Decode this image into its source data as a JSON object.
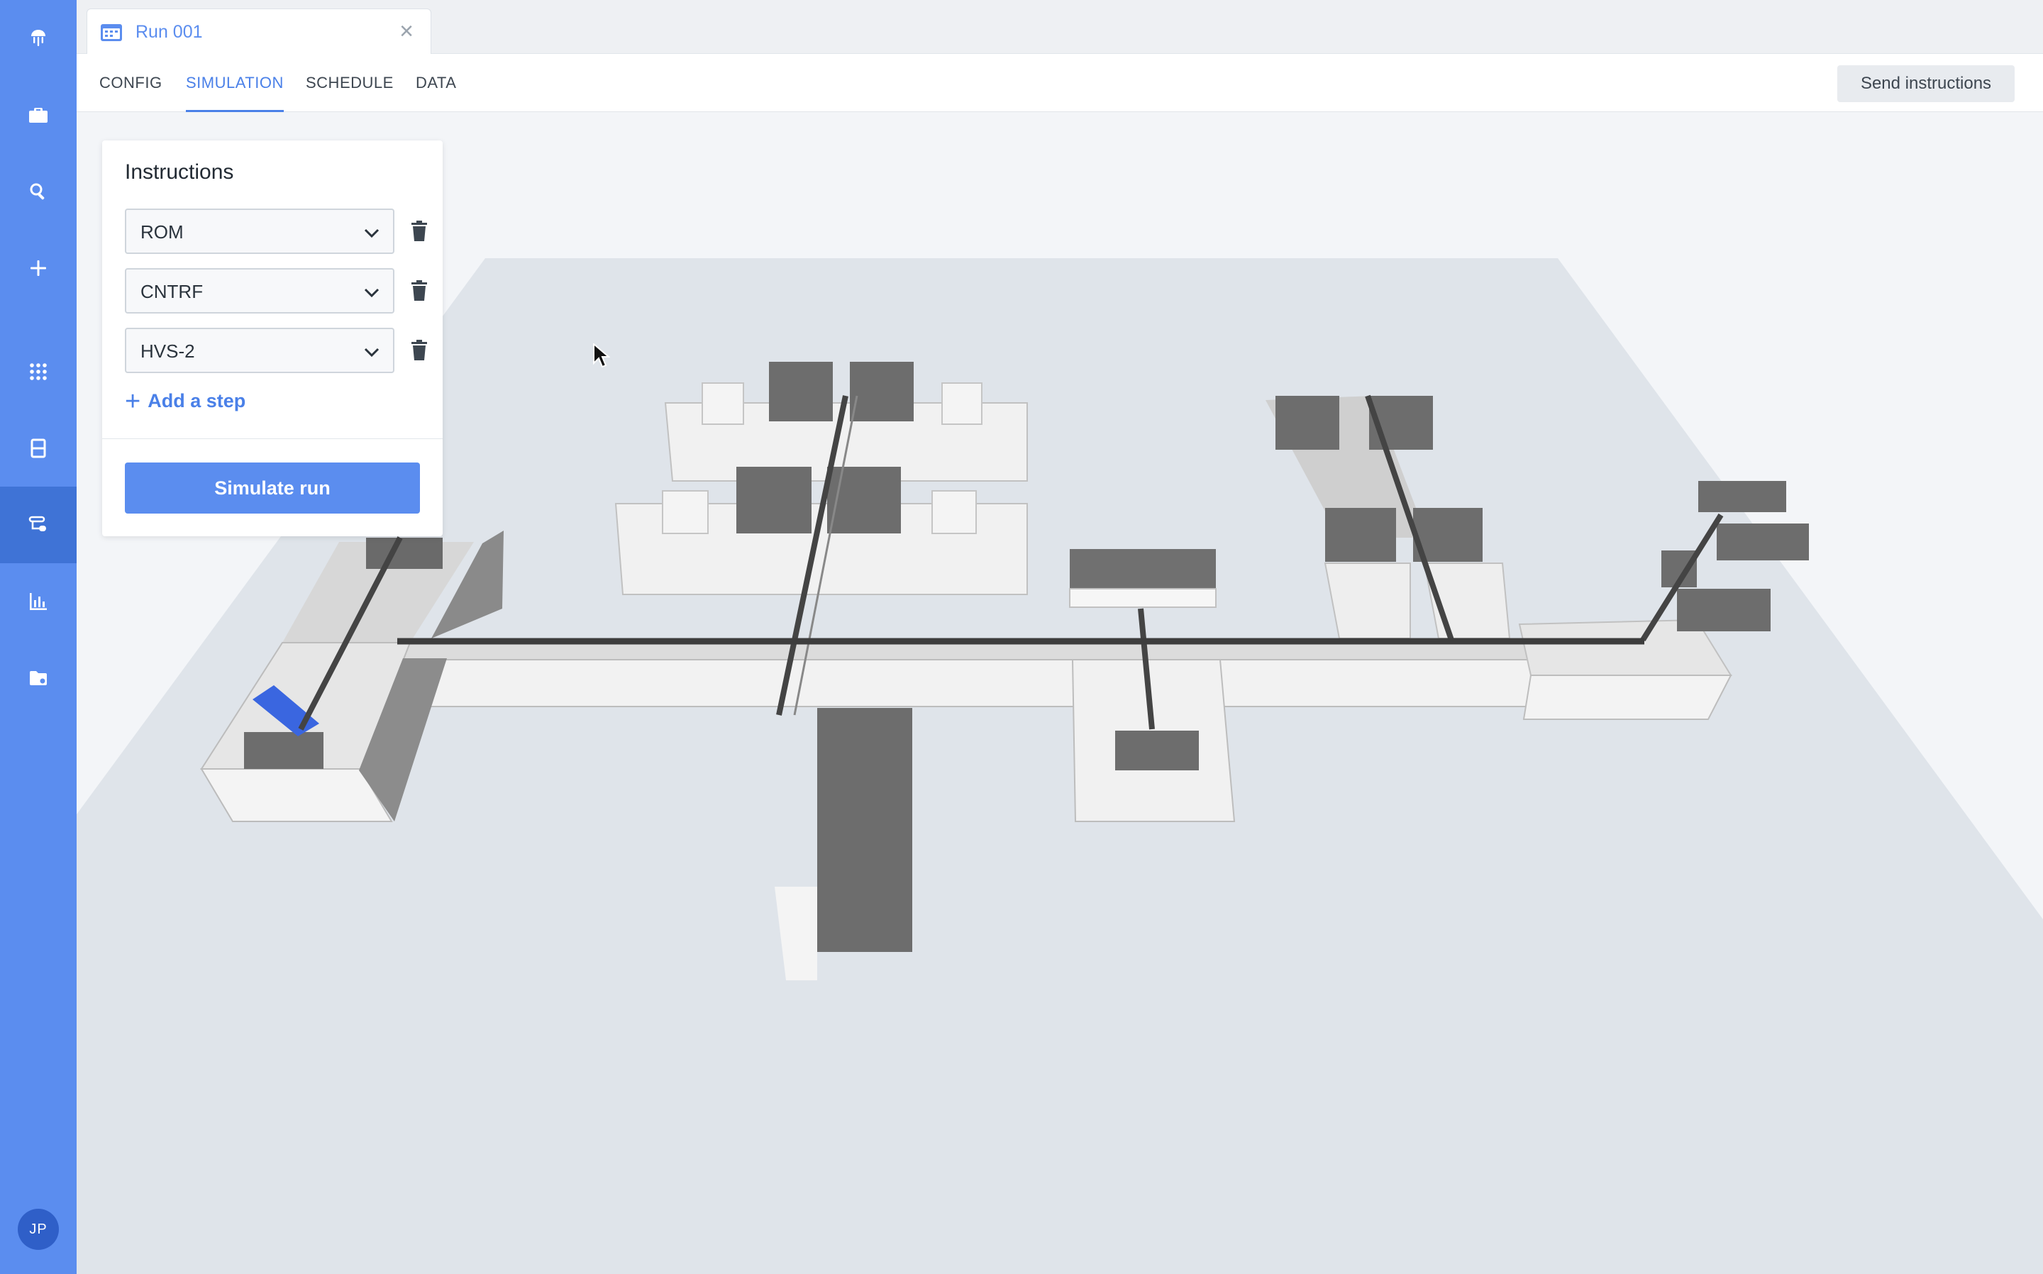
{
  "sidebar": {
    "items": [
      {
        "name": "logo",
        "icon": "jellyfish-logo-icon"
      },
      {
        "name": "briefcase",
        "icon": "briefcase-icon"
      },
      {
        "name": "search",
        "icon": "search-icon"
      },
      {
        "name": "add",
        "icon": "plus-icon"
      },
      {
        "name": "apps",
        "icon": "grid-icon"
      },
      {
        "name": "layout",
        "icon": "layout-icon"
      },
      {
        "name": "workflows",
        "icon": "workflow-icon",
        "active": true
      },
      {
        "name": "analytics",
        "icon": "bar-chart-icon"
      },
      {
        "name": "files",
        "icon": "folder-icon"
      }
    ],
    "avatar_initials": "JP",
    "color": "#5b8def",
    "active_color": "#3f73d6"
  },
  "window_tab": {
    "title": "Run 001",
    "icon": "calendar-icon",
    "close_icon": "close-icon"
  },
  "subnav": {
    "tabs": [
      {
        "label": "CONFIG",
        "active": false
      },
      {
        "label": "SIMULATION",
        "active": true
      },
      {
        "label": "SCHEDULE",
        "active": false
      },
      {
        "label": "DATA",
        "active": false
      }
    ],
    "send_label": "Send instructions"
  },
  "instructions": {
    "title": "Instructions",
    "steps": [
      {
        "value": "ROM"
      },
      {
        "value": "CNTRF"
      },
      {
        "value": "HVS-2"
      }
    ],
    "add_label": "Add a step",
    "simulate_label": "Simulate run"
  },
  "colors": {
    "accent": "#5b8def",
    "active_tab": "#4a80e8",
    "highlight_instrument": "#3a66e0"
  }
}
